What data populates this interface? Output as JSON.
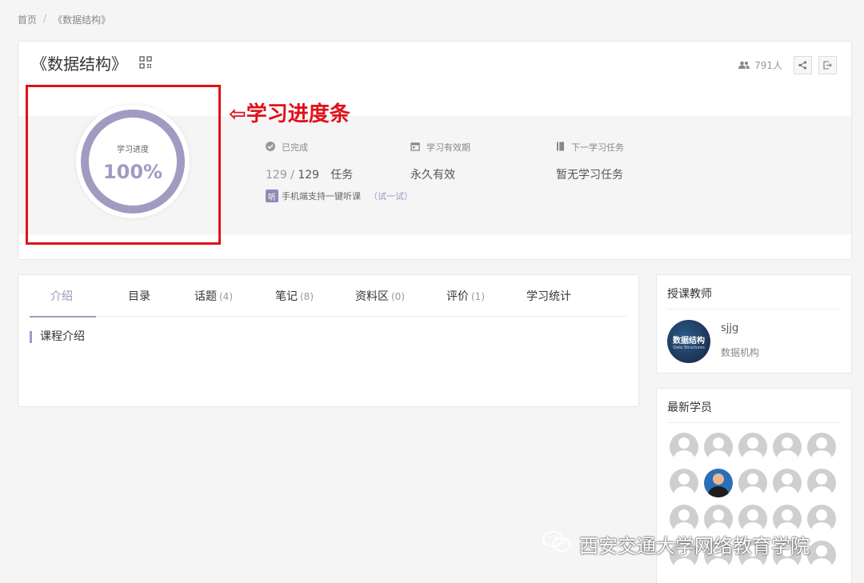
{
  "breadcrumb": {
    "home": "首页",
    "separator": "/",
    "current": "《数据结构》"
  },
  "header": {
    "title": "《数据结构》",
    "members": "791人"
  },
  "progress": {
    "label": "学习进度",
    "value_text": "100%",
    "value": 1.0
  },
  "stats": {
    "completed": {
      "label": "已完成",
      "done": "129",
      "slash": " / ",
      "total": "129",
      "unit": "任务"
    },
    "validity": {
      "label": "学习有效期",
      "value": "永久有效"
    },
    "next_task": {
      "label": "下一学习任务",
      "value": "暂无学习任务"
    },
    "listen": {
      "badge": "听",
      "text": "手机端支持一键听课",
      "try": "（试一试）"
    }
  },
  "annotation": {
    "text": "⇦学习进度条",
    "color": "#e0121a"
  },
  "tabs": [
    {
      "label": "介绍",
      "count": ""
    },
    {
      "label": "目录",
      "count": ""
    },
    {
      "label": "话题",
      "count": "(4)"
    },
    {
      "label": "笔记",
      "count": "(8)"
    },
    {
      "label": "资料区",
      "count": "(0)"
    },
    {
      "label": "评价",
      "count": "(1)"
    },
    {
      "label": "学习统计",
      "count": ""
    }
  ],
  "intro": {
    "section_title": "课程介绍"
  },
  "teacher": {
    "heading": "授课教师",
    "avatar_text": "数据结构",
    "avatar_subtext": "Data Structures",
    "name": "sjjg",
    "org": "数据机构"
  },
  "students": {
    "heading": "最新学员"
  },
  "watermark": {
    "text": "西安交通大学网络教育学院"
  },
  "colors": {
    "accent": "#a19bc2",
    "annotation": "#e0121a",
    "background": "#f5f5f5"
  },
  "icons": [
    "qr-code-icon",
    "users-icon",
    "share-icon",
    "exit-icon",
    "check-circle-icon",
    "calendar-icon",
    "book-icon",
    "wechat-icon"
  ]
}
